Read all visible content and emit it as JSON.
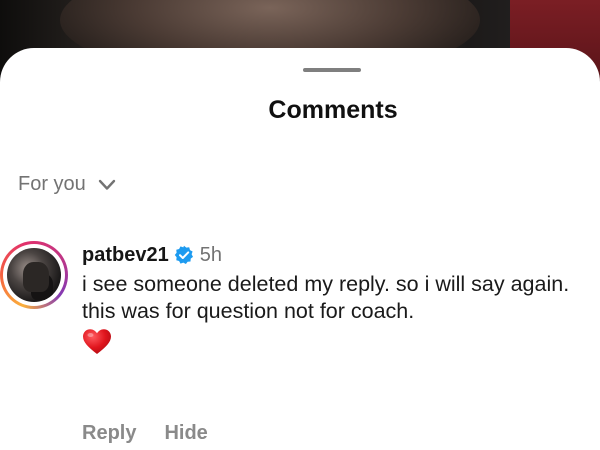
{
  "sheet": {
    "title": "Comments"
  },
  "filter": {
    "label": "For you",
    "icon": "chevron-down-icon"
  },
  "comment": {
    "username": "patbev21",
    "verified": true,
    "verified_icon": "verified-badge-icon",
    "verified_color": "#1d9bf0",
    "timestamp": "5h",
    "text": "i see someone deleted my reply. so i will say again. this was for question not for coach.",
    "emoji": "red-heart-icon",
    "emoji_color": "#e0151d",
    "avatar_ring_colors": [
      "#fbb03b",
      "#e1306c",
      "#833ab4"
    ],
    "actions": {
      "reply": "Reply",
      "hide": "Hide"
    }
  }
}
